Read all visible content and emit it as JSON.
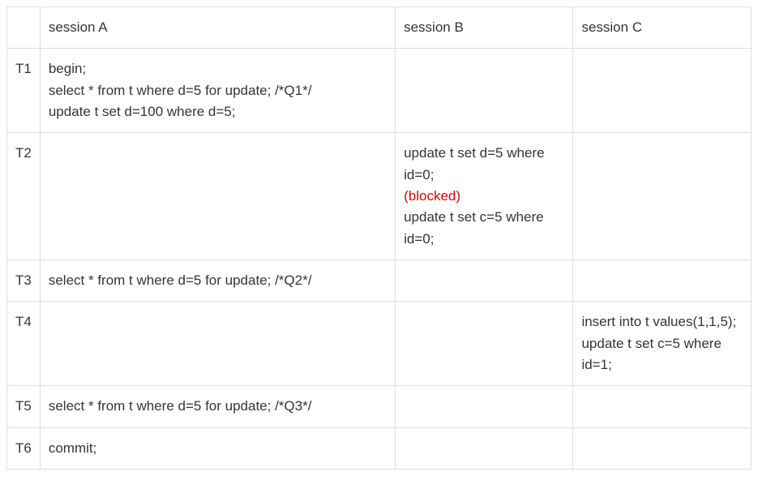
{
  "headers": {
    "time": "",
    "sessionA": "session A",
    "sessionB": "session B",
    "sessionC": "session C"
  },
  "rows": {
    "r0": {
      "time": "T1",
      "sessionA": "begin;\nselect * from t where d=5 for update; /*Q1*/\nupdate t set d=100 where d=5;",
      "sessionB": "",
      "sessionC": ""
    },
    "r1": {
      "time": "T2",
      "sessionA": "",
      "sessionB_line1": "update t set d=5 where id=0;",
      "sessionB_blocked": "(blocked)",
      "sessionB_line2": "update t set c=5 where id=0;",
      "sessionC": ""
    },
    "r2": {
      "time": "T3",
      "sessionA": "select * from t where d=5 for update; /*Q2*/",
      "sessionB": "",
      "sessionC": ""
    },
    "r3": {
      "time": "T4",
      "sessionA": "",
      "sessionB": "",
      "sessionC": "insert into t values(1,1,5);\nupdate t set c=5 where id=1;"
    },
    "r4": {
      "time": "T5",
      "sessionA": "select * from t where d=5 for update; /*Q3*/",
      "sessionB": "",
      "sessionC": ""
    },
    "r5": {
      "time": "T6",
      "sessionA": "commit;",
      "sessionB": "",
      "sessionC": ""
    }
  }
}
